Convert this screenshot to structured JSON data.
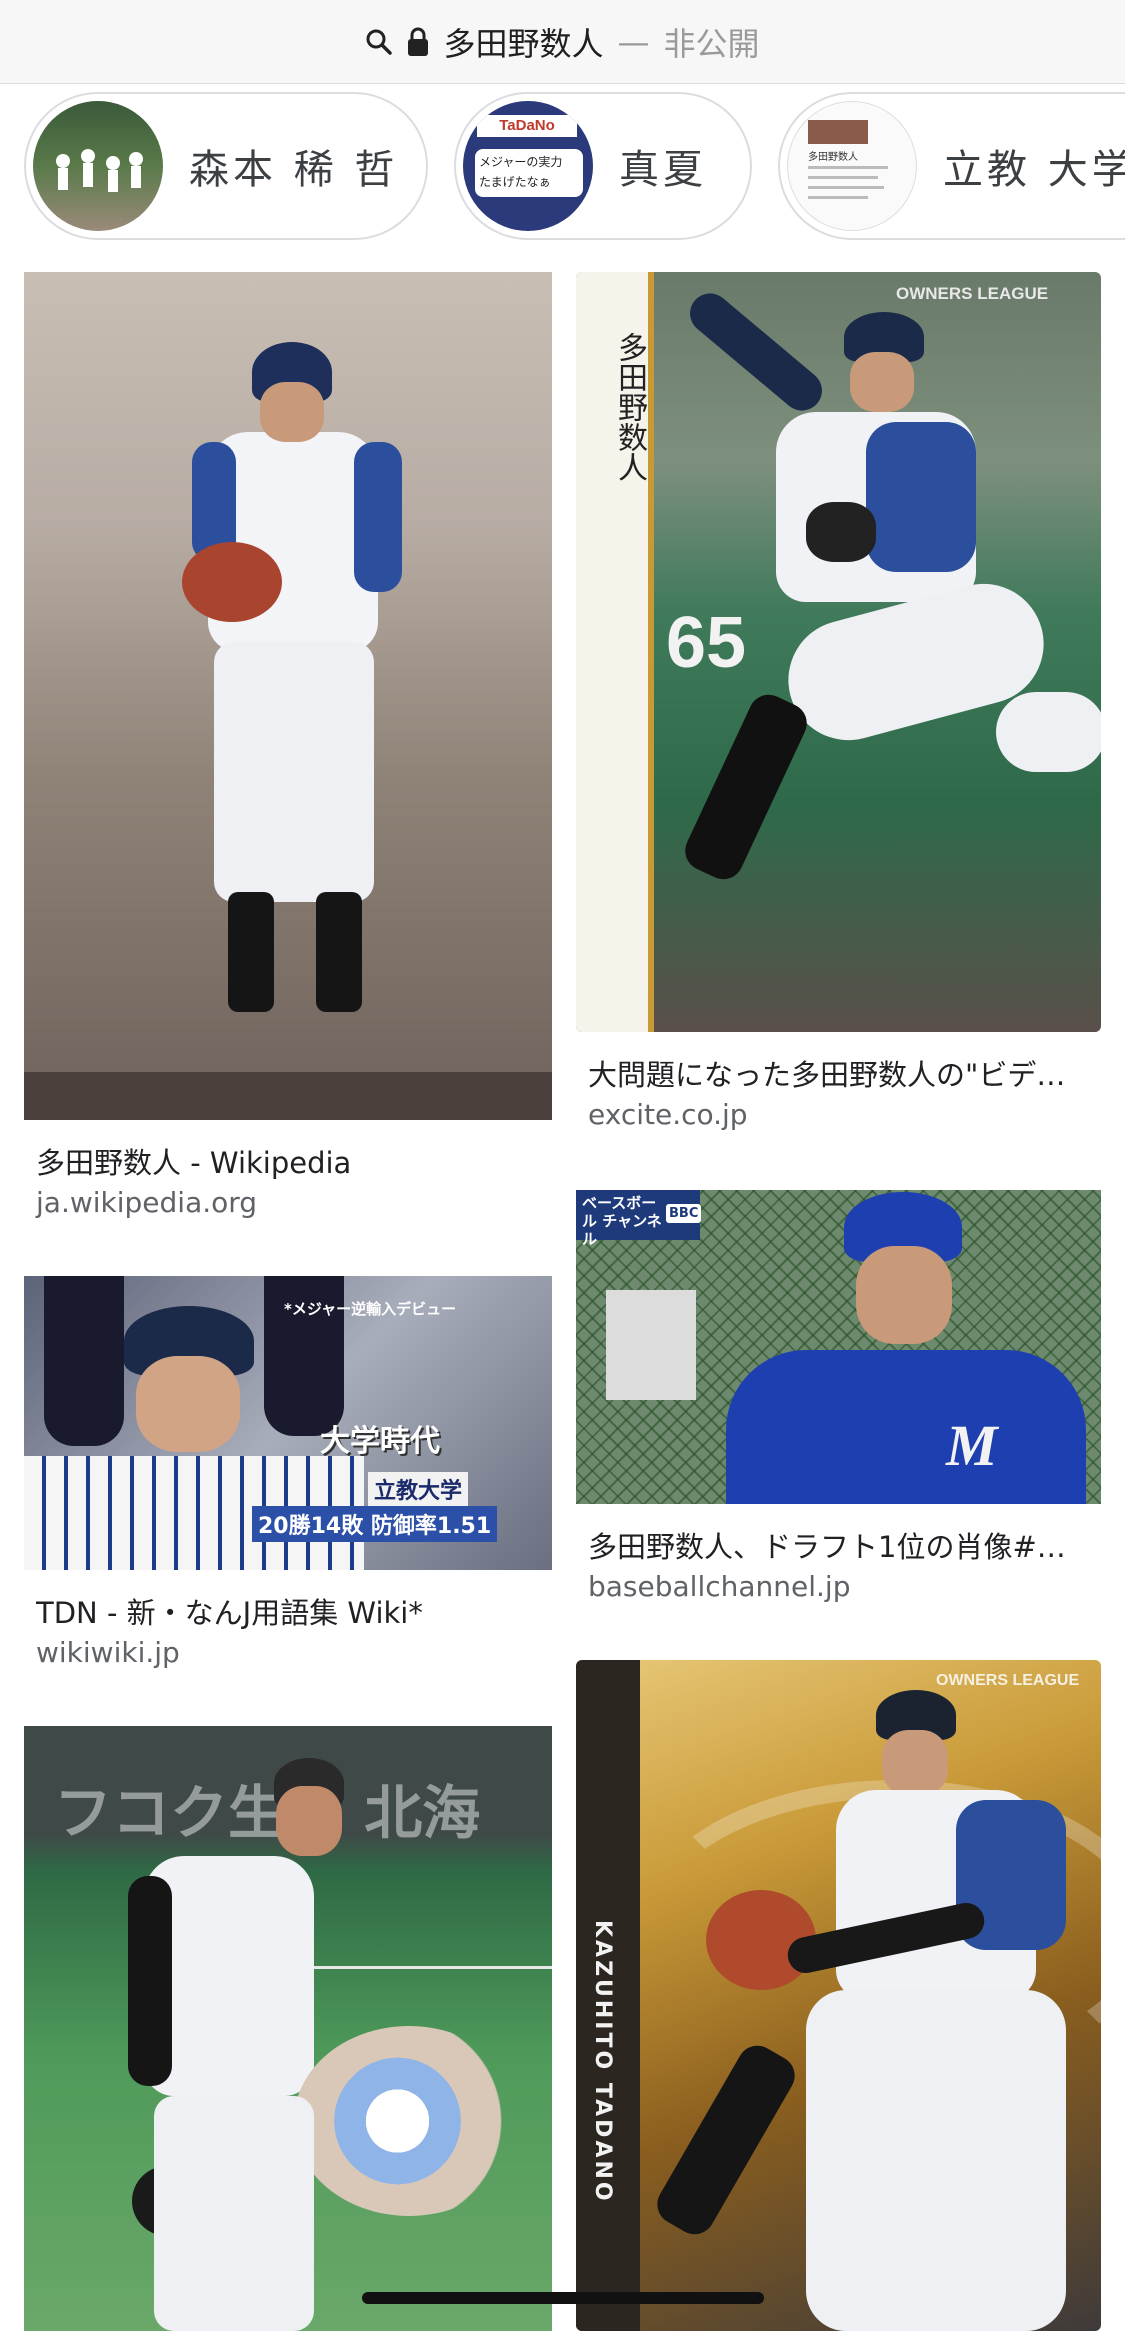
{
  "address_bar": {
    "site_title": "多田野数人",
    "separator": "—",
    "subtitle": "非公開",
    "icons": [
      "search-icon",
      "lock-icon"
    ]
  },
  "chips": [
    {
      "label": "森本 稀 哲"
    },
    {
      "label": "真夏"
    },
    {
      "label": "立教 大学"
    }
  ],
  "chip_thumb_texts": {
    "chip2_line1": "TaDaNo",
    "chip2_line2": "メジャーの実力",
    "chip2_line3": "たまげたなぁ",
    "chip3_line1": "多田野数人"
  },
  "results": [
    {
      "caption": "多田野数人 - Wikipedia",
      "source": "ja.wikipedia.org"
    },
    {
      "caption": "大問題になった多田野数人の\"ビデ…",
      "source": "excite.co.jp"
    },
    {
      "caption": "TDN - 新・なんJ用語集 Wiki*",
      "source": "wikiwiki.jp"
    },
    {
      "caption": "多田野数人、ドラフト1位の肖像#…",
      "source": "baseballchannel.jp"
    }
  ],
  "image_texts": {
    "card1_name": "多田野数人",
    "card1_number": "65",
    "card1_brand": "OWNERS LEAGUE",
    "tv_top": "*メジャー逆輸入デビュー",
    "tv_era": "大学時代",
    "tv_school": "立教大学",
    "tv_stats": "20勝14敗 防御率1.51",
    "bbc_logo": "ベースボール チャンネル",
    "bbc_badge": "BBC",
    "card2_brand": "OWNERS LEAGUE",
    "card2_name": "KAZUHITO TADANO",
    "stadium_sign": "フコク生命  北海"
  },
  "colors": {
    "fighters_blue": "#2b4f9c",
    "marines_blue": "#1d3fb0",
    "card_gold": "#b8862a",
    "turf_green": "#5b9a5a",
    "dirt": "#7b6e66"
  }
}
